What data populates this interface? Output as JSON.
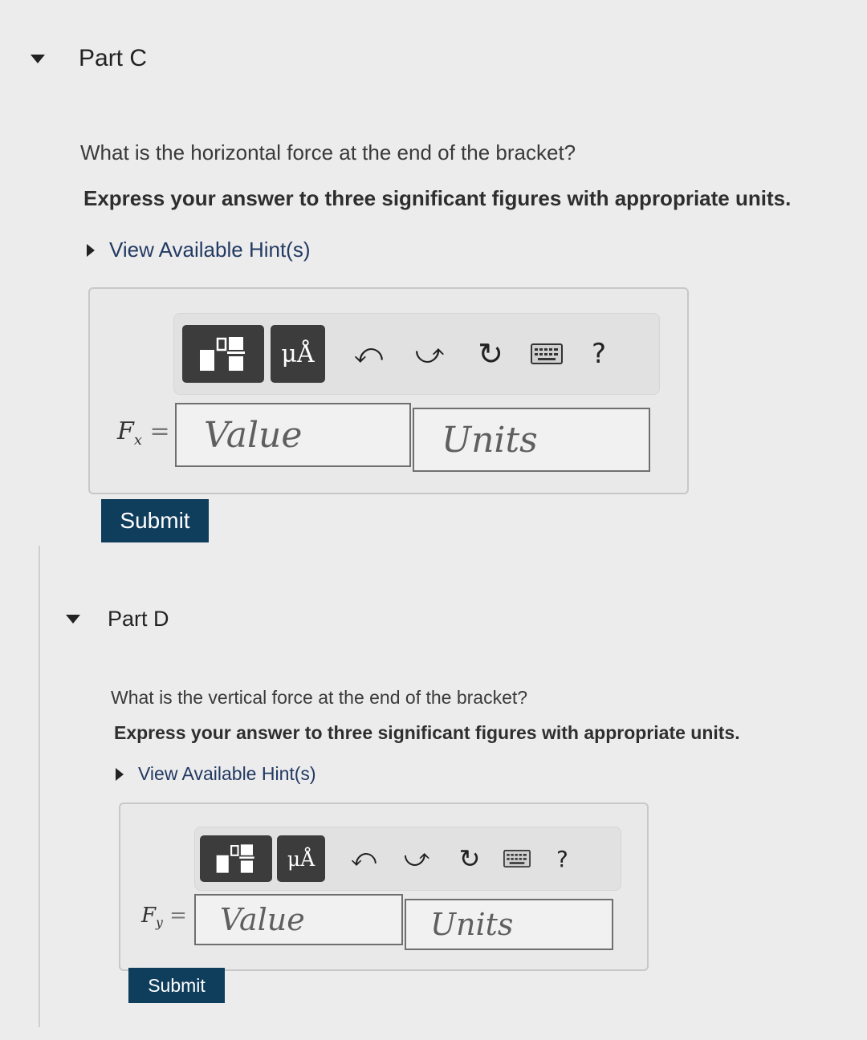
{
  "parts": [
    {
      "title": "Part C",
      "question": "What is the horizontal force at the end of the bracket?",
      "instruction": "Express your answer to three significant figures with appropriate units.",
      "hints_label": "View Available Hint(s)",
      "variable": "F",
      "variable_sub": "x",
      "equals": "=",
      "value_placeholder": "Value",
      "units_placeholder": "Units",
      "submit_label": "Submit",
      "unit_button": "μÅ",
      "help_symbol": "?"
    },
    {
      "title": "Part D",
      "question": "What is the vertical force at the end of the bracket?",
      "instruction": "Express your answer to three significant figures with appropriate units.",
      "hints_label": "View Available Hint(s)",
      "variable": "F",
      "variable_sub": "y",
      "equals": "=",
      "value_placeholder": "Value",
      "units_placeholder": "Units",
      "submit_label": "Submit",
      "unit_button": "μÅ",
      "help_symbol": "?"
    }
  ],
  "icons": [
    "templates-icon",
    "undo-icon",
    "redo-icon",
    "reset-icon",
    "keyboard-icon",
    "help-icon"
  ],
  "colors": {
    "submit": "#0f3d5c",
    "hint_link": "#233a63",
    "toolbar_button": "#3c3c3c"
  }
}
